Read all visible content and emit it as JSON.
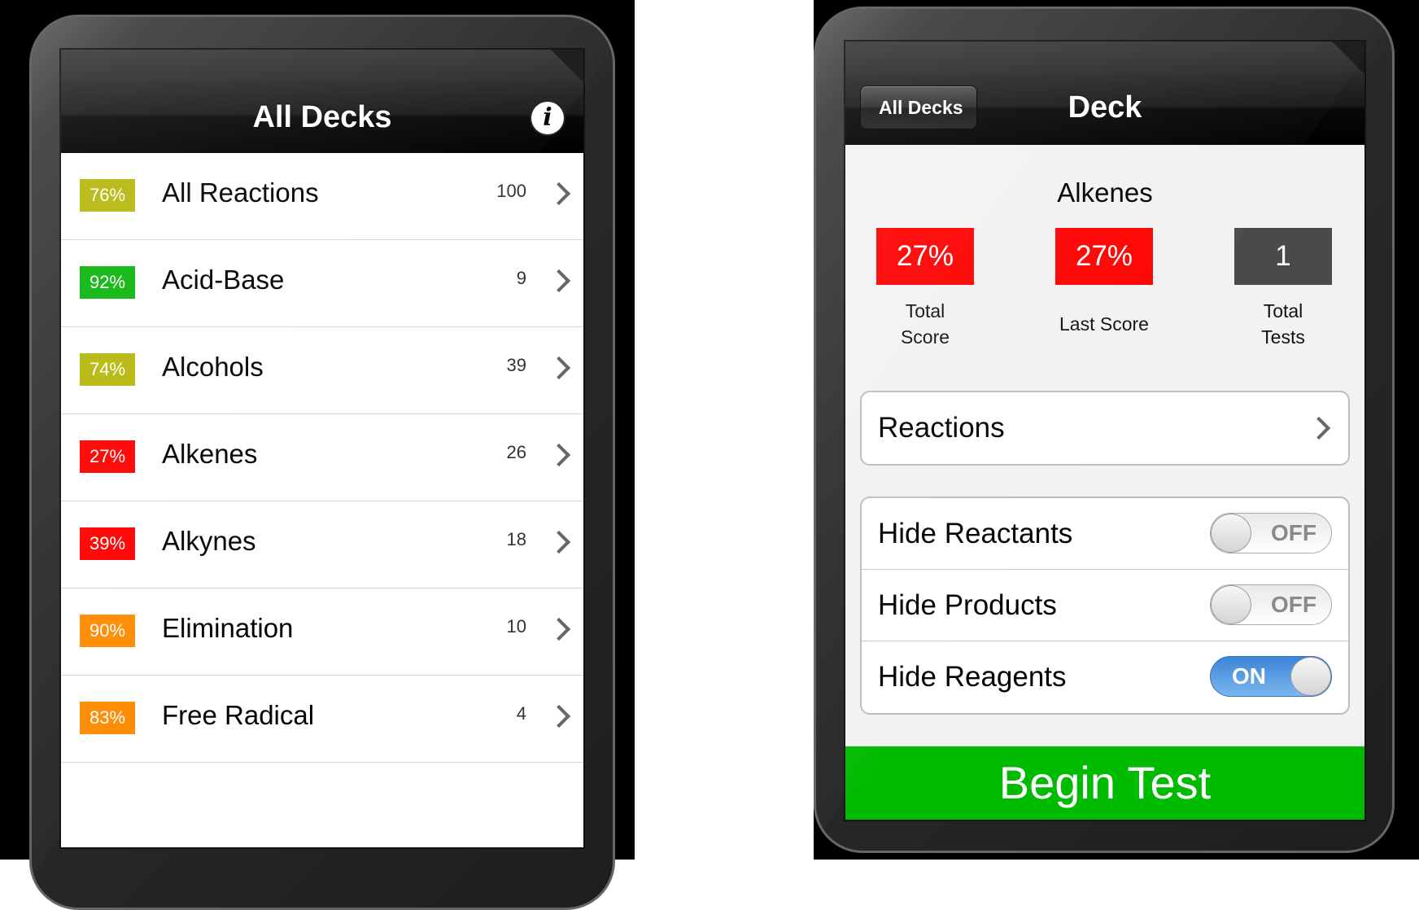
{
  "left_screen": {
    "title": "All Decks",
    "info_icon": "i",
    "decks": [
      {
        "pct": "76%",
        "name": "All Reactions",
        "count": "100",
        "color": "#b5b80b"
      },
      {
        "pct": "92%",
        "name": "Acid-Base",
        "count": "9",
        "color": "#0bb50b"
      },
      {
        "pct": "74%",
        "name": "Alcohols",
        "count": "39",
        "color": "#b5b80b"
      },
      {
        "pct": "27%",
        "name": "Alkenes",
        "count": "26",
        "color": "#ff0000"
      },
      {
        "pct": "39%",
        "name": "Alkynes",
        "count": "18",
        "color": "#ff0000"
      },
      {
        "pct": "90%",
        "name": "Elimination",
        "count": "10",
        "color": "#ff8a00"
      },
      {
        "pct": "83%",
        "name": "Free Radical",
        "count": "4",
        "color": "#ff8a00"
      }
    ]
  },
  "right_screen": {
    "back_label": "All Decks",
    "title": "Deck",
    "deck_name": "Alkenes",
    "stats": {
      "total_score": {
        "value": "27%",
        "label_line1": "Total",
        "label_line2": "Score",
        "color": "#ff0000"
      },
      "last_score": {
        "value": "27%",
        "label": "Last Score",
        "color": "#ff0000"
      },
      "total_tests": {
        "value": "1",
        "label_line1": "Total",
        "label_line2": "Tests",
        "color": "#4a4a4a"
      }
    },
    "reactions_label": "Reactions",
    "toggles": [
      {
        "label": "Hide Reactants",
        "state": "OFF"
      },
      {
        "label": "Hide Products",
        "state": "OFF"
      },
      {
        "label": "Hide Reagents",
        "state": "ON"
      }
    ],
    "begin_label": "Begin Test"
  }
}
